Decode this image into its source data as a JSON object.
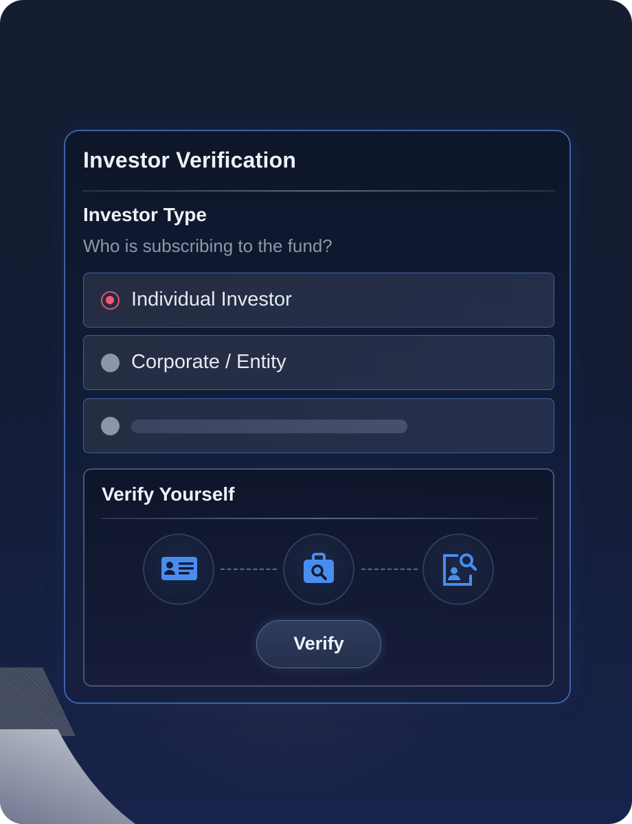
{
  "card": {
    "title": "Investor Verification"
  },
  "investor_type": {
    "title": "Investor Type",
    "question": "Who is subscribing to the fund?",
    "options": [
      {
        "label": "Individual Investor",
        "selected": true
      },
      {
        "label": "Corporate / Entity",
        "selected": false
      },
      {
        "label": "",
        "selected": false
      }
    ]
  },
  "verify": {
    "title": "Verify Yourself",
    "steps": [
      {
        "icon": "id-card-icon"
      },
      {
        "icon": "briefcase-search-icon"
      },
      {
        "icon": "profile-search-icon"
      }
    ],
    "button_label": "Verify"
  },
  "colors": {
    "accent": "#3f64a4",
    "selected_radio": "#f05a70",
    "icon_blue": "#4a8df0",
    "background": "#151d31"
  }
}
